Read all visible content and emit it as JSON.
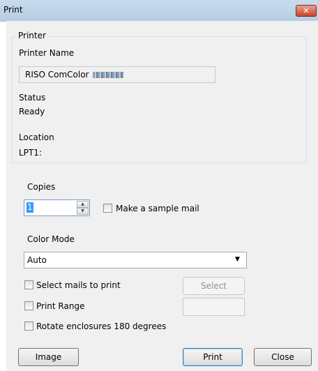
{
  "window": {
    "title": "Print",
    "close_glyph": "✕"
  },
  "printer_group": {
    "legend": "Printer",
    "printer_name_label": "Printer Name",
    "printer_name_value": "RISO ComColor",
    "status_label": "Status",
    "status_value": "Ready",
    "location_label": "Location",
    "location_value": "LPT1:"
  },
  "copies": {
    "label": "Copies",
    "value": "1",
    "spin_up_glyph": "▲",
    "spin_down_glyph": "▼",
    "sample_mail_label": "Make a sample mail",
    "sample_mail_checked": false
  },
  "color_mode": {
    "label": "Color Mode",
    "selected": "Auto",
    "arrow_glyph": "▼"
  },
  "options": {
    "select_mails_label": "Select mails to print",
    "select_button_label": "Select",
    "print_range_label": "Print Range",
    "rotate_label": "Rotate enclosures 180 degrees"
  },
  "buttons": {
    "image": "Image",
    "print": "Print",
    "close": "Close"
  },
  "icons": [
    "close-icon",
    "spin-up-icon",
    "spin-down-icon",
    "dropdown-arrow-icon"
  ]
}
